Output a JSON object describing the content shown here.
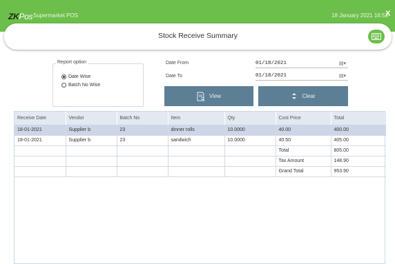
{
  "titlebar": {
    "logo_text": "ZK",
    "logo_suffix": "Pos",
    "app_name": "Supermarket POS",
    "datetime": "18 January 2021 16:53",
    "close_label": "X"
  },
  "header": {
    "title": "Stock Receive Summary",
    "keyboard_icon": "keyboard-icon"
  },
  "report_option": {
    "legend": "Report option",
    "options": [
      {
        "label": "Date Wise",
        "checked": true
      },
      {
        "label": "Batch No Wise",
        "checked": false
      }
    ]
  },
  "date_from": {
    "label": "Date From",
    "value": "01/18/2021"
  },
  "date_to": {
    "label": "Date To",
    "value": "01/18/2021"
  },
  "buttons": {
    "view": "View",
    "clear": "Clear"
  },
  "colors": {
    "brand_green": "#6dbf4b",
    "button_blue": "#5d7f96",
    "row_selected": "#cdd5e6"
  },
  "table": {
    "columns": [
      "Receive Date",
      "Vendor",
      "Batch No",
      "Item",
      "Qty",
      "Cost Price",
      "Total"
    ],
    "rows": [
      [
        "18-01-2021",
        "Supplier b",
        "23",
        "dinner rolls",
        "10.0000",
        "40.00",
        "400.00"
      ],
      [
        "18-01-2021",
        "Supplier b",
        "23",
        "sandwich",
        "10.0000",
        "40.50",
        "405.00"
      ],
      [
        "",
        "",
        "",
        "",
        "",
        "Total",
        "805.00"
      ],
      [
        "",
        "",
        "",
        "",
        "",
        "Tax Amount",
        "148.90"
      ],
      [
        "",
        "",
        "",
        "",
        "",
        "Grand Total",
        "953.90"
      ]
    ]
  }
}
